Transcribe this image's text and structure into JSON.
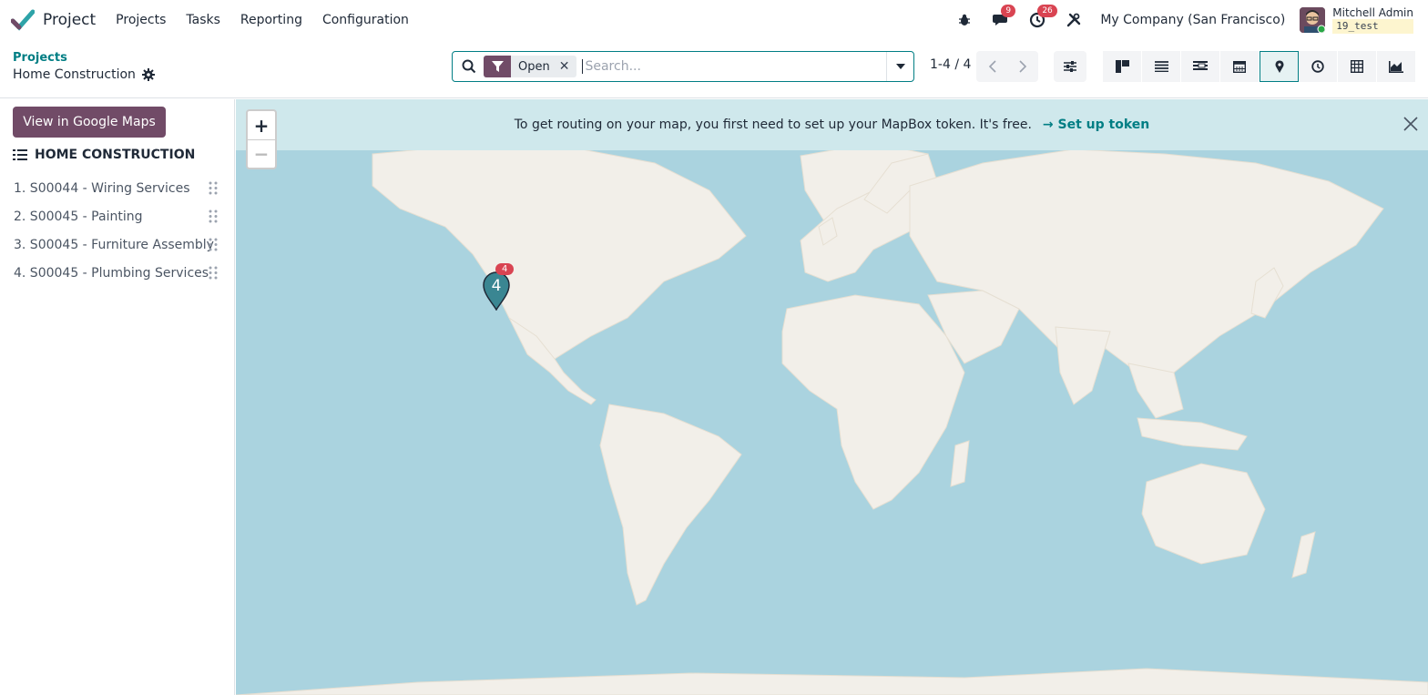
{
  "app": {
    "name": "Project"
  },
  "menu": [
    "Projects",
    "Tasks",
    "Reporting",
    "Configuration"
  ],
  "systray": {
    "messages_count": "9",
    "activities_count": "26",
    "company": "My Company (San Francisco)",
    "user_name": "Mitchell Admin",
    "db_name": "19_test"
  },
  "breadcrumb": {
    "parent": "Projects",
    "current": "Home Construction"
  },
  "search": {
    "facet": "Open",
    "placeholder": "Search..."
  },
  "pager": {
    "text": "1-4 / 4"
  },
  "views": [
    "kanban-icon",
    "list-icon",
    "gantt-icon",
    "calendar-icon",
    "map-icon",
    "activity-icon",
    "pivot-icon",
    "graph-icon"
  ],
  "active_view": "map",
  "sidebar": {
    "google_maps_button": "View in Google Maps",
    "group_title": "HOME CONSTRUCTION",
    "records": [
      "1. S00044 - Wiring Services",
      "2. S00045 - Painting",
      "3. S00045 - Furniture Assembly",
      "4. S00045 - Plumbing Services"
    ]
  },
  "map": {
    "banner_text": "To get routing on your map, you first need to set up your MapBox token. It's free.",
    "banner_link": "→ Set up token",
    "zoom_in": "+",
    "zoom_out": "−",
    "marker_label": "4",
    "marker_count": "4"
  },
  "colors": {
    "brand": "#714b67",
    "accent": "#017e84",
    "water": "#aad3df",
    "land": "#f2efe9",
    "badge": "#d94452"
  }
}
